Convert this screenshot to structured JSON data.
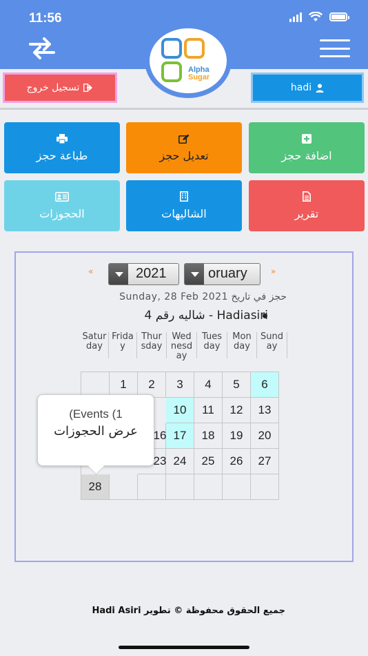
{
  "status_bar": {
    "time": "11:56"
  },
  "header": {
    "logo_line1": "Alpha",
    "logo_line2": "Sugar",
    "colors": {
      "background": "#5b8ee6"
    }
  },
  "user_bar": {
    "logout_label": "تسجيل خروج",
    "user_label": "hadi"
  },
  "tiles": [
    {
      "key": "print",
      "label": "طباعة حجز",
      "icon": "printer-icon",
      "color": "#1593e2"
    },
    {
      "key": "edit",
      "label": "تعديل حجز",
      "icon": "edit-icon",
      "color": "#f98c07"
    },
    {
      "key": "add",
      "label": "اضافة حجز",
      "icon": "plus-square-icon",
      "color": "#52c47c"
    },
    {
      "key": "bookings",
      "label": "الحجوزات",
      "icon": "id-card-icon",
      "color": "#6fd3e8"
    },
    {
      "key": "chalets",
      "label": "الشاليهات",
      "icon": "building-icon",
      "color": "#1593e2"
    },
    {
      "key": "report",
      "label": "تقرير",
      "icon": "file-icon",
      "color": "#f05a5a"
    }
  ],
  "calendar": {
    "prev_arrow": "«",
    "next_arrow": "»",
    "year": "2021",
    "month": "February",
    "month_visible": "oruary",
    "date_line": "حجز في تاريخ Sunday, 28 Feb 2021",
    "booking_line": "Hadiasiri - شاليه رقم 4",
    "weekdays": [
      "Saturday",
      "Friday",
      "Thursday",
      "Wednesday",
      "Tuesday",
      "Monday",
      "Sunday"
    ],
    "weekday_labels": [
      "Satur day",
      "Frida y",
      "Thur sday",
      "Wed nesd ay",
      "Tues day",
      "Mon day",
      "Sund ay"
    ],
    "days": [
      "1",
      "2",
      "3",
      "4",
      "5",
      "6",
      "10",
      "11",
      "12",
      "13",
      "16",
      "17",
      "18",
      "19",
      "20",
      "23",
      "24",
      "25",
      "26",
      "27",
      "28"
    ],
    "highlighted_days": [
      "6",
      "10",
      "17"
    ],
    "selected_day": "28",
    "highlight_color": "#c2fbfb"
  },
  "tooltip": {
    "events": "(Events (1",
    "action": "عرض الحجوزات"
  },
  "footer": {
    "text": "جميع الحقوق محفوظة © تطوير Hadi Asiri"
  }
}
